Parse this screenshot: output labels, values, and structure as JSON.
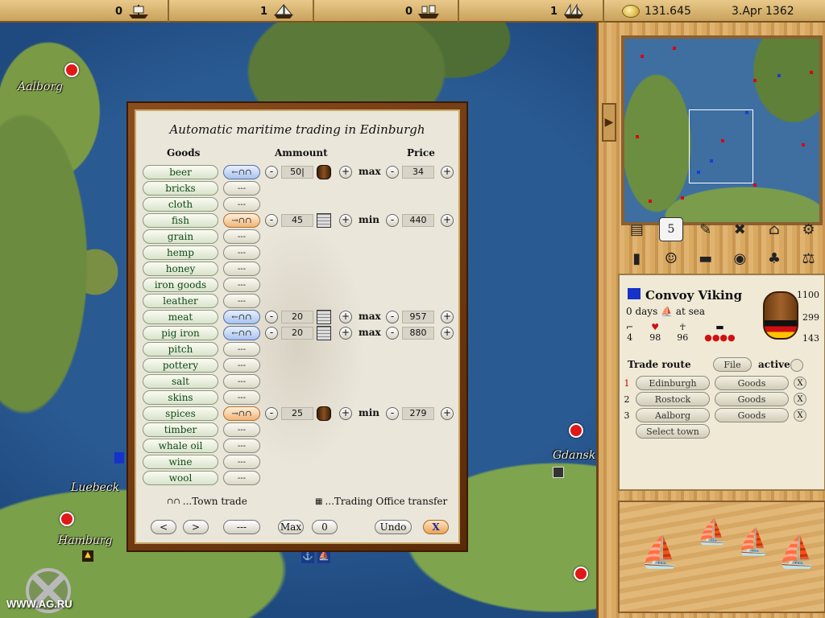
{
  "topbar": {
    "ships": [
      {
        "count": "0",
        "icon": "cog-ship-icon"
      },
      {
        "count": "1",
        "icon": "snaikka-ship-icon"
      },
      {
        "count": "0",
        "icon": "hulk-ship-icon"
      },
      {
        "count": "1",
        "icon": "crayer-ship-icon"
      }
    ],
    "gold": "131.645",
    "date": "3.Apr 1362"
  },
  "map": {
    "cities": [
      {
        "name": "Aalborg"
      },
      {
        "name": "Luebeck"
      },
      {
        "name": "Hamburg"
      },
      {
        "name": "Gdansk"
      }
    ],
    "watermark": "WWW.AG.RU"
  },
  "dialog": {
    "title": "Automatic maritime trading in Edinburgh",
    "headers": {
      "goods": "Goods",
      "amount": "Ammount",
      "price": "Price"
    },
    "rows": [
      {
        "good": "beer",
        "mode": "buy",
        "mode_label": "←∩∩",
        "amount": "50|",
        "storage": "barrel",
        "limit": "max",
        "price": "34"
      },
      {
        "good": "bricks",
        "mode": "none",
        "mode_label": "---"
      },
      {
        "good": "cloth",
        "mode": "none",
        "mode_label": "---"
      },
      {
        "good": "fish",
        "mode": "sell",
        "mode_label": "→∩∩",
        "amount": "45",
        "storage": "crate",
        "limit": "min",
        "price": "440"
      },
      {
        "good": "grain",
        "mode": "none",
        "mode_label": "---"
      },
      {
        "good": "hemp",
        "mode": "none",
        "mode_label": "---"
      },
      {
        "good": "honey",
        "mode": "none",
        "mode_label": "---"
      },
      {
        "good": "iron goods",
        "mode": "none",
        "mode_label": "---"
      },
      {
        "good": "leather",
        "mode": "none",
        "mode_label": "---"
      },
      {
        "good": "meat",
        "mode": "buy",
        "mode_label": "←∩∩",
        "amount": "20",
        "storage": "crate",
        "limit": "max",
        "price": "957"
      },
      {
        "good": "pig iron",
        "mode": "buy",
        "mode_label": "←∩∩",
        "amount": "20",
        "storage": "crate",
        "limit": "max",
        "price": "880"
      },
      {
        "good": "pitch",
        "mode": "none",
        "mode_label": "---"
      },
      {
        "good": "pottery",
        "mode": "none",
        "mode_label": "---"
      },
      {
        "good": "salt",
        "mode": "none",
        "mode_label": "---"
      },
      {
        "good": "skins",
        "mode": "none",
        "mode_label": "---"
      },
      {
        "good": "spices",
        "mode": "sell",
        "mode_label": "→∩∩",
        "amount": "25",
        "storage": "barrel",
        "limit": "min",
        "price": "279"
      },
      {
        "good": "timber",
        "mode": "none",
        "mode_label": "---"
      },
      {
        "good": "whale oil",
        "mode": "none",
        "mode_label": "---"
      },
      {
        "good": "wine",
        "mode": "none",
        "mode_label": "---"
      },
      {
        "good": "wool",
        "mode": "none",
        "mode_label": "---"
      }
    ],
    "legend": {
      "town_trade": "...Town trade",
      "office_transfer": "...Trading Office transfer"
    },
    "buttons": {
      "prev": "<",
      "next": ">",
      "none": "---",
      "max": "Max",
      "zero": "0",
      "undo": "Undo",
      "close": "X"
    }
  },
  "convoy": {
    "name": "Convoy Viking",
    "status_days": "0 days",
    "status_where": "at sea",
    "stats": {
      "cannons": "4",
      "health": "98",
      "sailors": "96"
    },
    "capacity": {
      "max": "1100",
      "current": "299",
      "free": "143"
    },
    "trade_route_label": "Trade route",
    "file_label": "File",
    "active_label": "active",
    "routes": [
      {
        "num": "1",
        "town": "Edinburgh",
        "goods": "Goods",
        "remove": "X"
      },
      {
        "num": "2",
        "town": "Rostock",
        "goods": "Goods",
        "remove": "X"
      },
      {
        "num": "3",
        "town": "Aalborg",
        "goods": "Goods",
        "remove": "X"
      }
    ],
    "select_town": "Select town"
  },
  "colors": {
    "buy_accent": "#a9c2ec",
    "sell_accent": "#f0b478",
    "goods_text": "#0e4a14",
    "city_dot": "#e01818"
  }
}
